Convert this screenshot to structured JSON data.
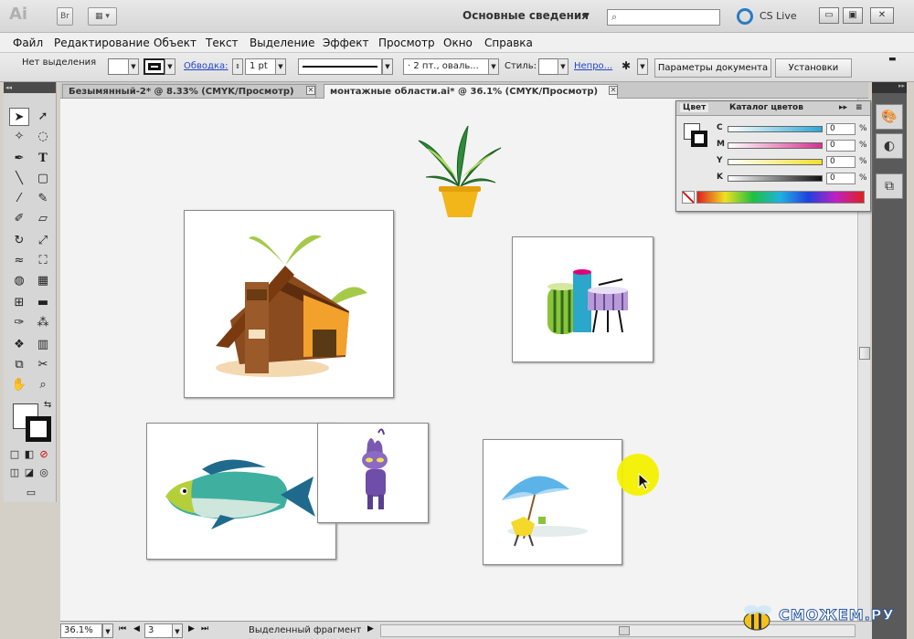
{
  "titlebar": {
    "app_logo": "Ai",
    "bridge_btn": "Br",
    "workspace": "Основные сведения",
    "search_placeholder": "",
    "cslive": "CS Live",
    "win_min": "▭",
    "win_max": "▣",
    "win_close": "✕"
  },
  "menu": [
    "Файл",
    "Редактирование",
    "Объект",
    "Текст",
    "Выделение",
    "Эффект",
    "Просмотр",
    "Окно",
    "Справка"
  ],
  "control": {
    "selection": "Нет выделения",
    "stroke_link": "Обводка:",
    "stroke_weight": "1 pt",
    "brush": "2 пт., оваль...",
    "style_label": "Стиль:",
    "opacity_link": "Непро...",
    "doc_settings": "Параметры документа",
    "preferences": "Установки"
  },
  "tabs": [
    {
      "label": "Безымянный-2* @ 8.33% (CMYK/Просмотр)"
    },
    {
      "label": "монтажные области.ai* @ 36.1% (CMYK/Просмотр)"
    }
  ],
  "color_panel": {
    "tab_color": "Цвет",
    "tab_catalog": "Каталог цветов",
    "channels": [
      {
        "name": "C",
        "value": "0",
        "pct": "%",
        "color": "#2aa7d9"
      },
      {
        "name": "M",
        "value": "0",
        "pct": "%",
        "color": "#d6328f"
      },
      {
        "name": "Y",
        "value": "0",
        "pct": "%",
        "color": "#f3df2a"
      },
      {
        "name": "K",
        "value": "0",
        "pct": "%",
        "color": "#111111"
      }
    ]
  },
  "status": {
    "zoom": "36.1%",
    "artboard_num": "3",
    "info": "Выделенный фрагмент"
  },
  "watermark": "СМОЖЕМ.РУ",
  "icons": {
    "selection": "selection-tool-icon",
    "direct_selection": "direct-selection-tool-icon",
    "pen": "pen-tool-icon",
    "type": "type-tool-icon"
  }
}
